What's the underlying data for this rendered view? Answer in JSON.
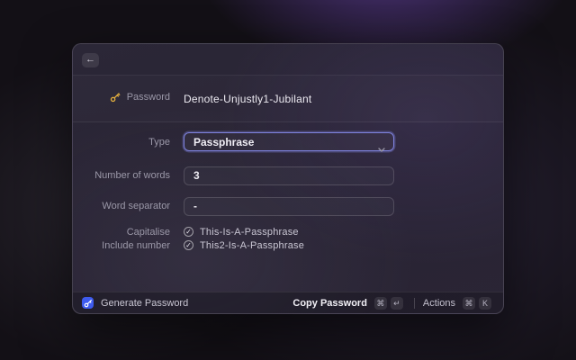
{
  "window": {
    "back_icon": "←",
    "header": {
      "field_label": "Password",
      "password_value": "Denote-Unjustly1-Jubilant"
    },
    "form": {
      "type": {
        "label": "Type",
        "value": "Passphrase"
      },
      "number_of_words": {
        "label": "Number of words",
        "value": "3"
      },
      "word_separator": {
        "label": "Word separator",
        "value": "-"
      },
      "capitalise": {
        "label": "Capitalise",
        "value": "This-Is-A-Passphrase",
        "checked": true
      },
      "include_number": {
        "label": "Include number",
        "value": "This2-Is-A-Passphrase",
        "checked": true
      }
    },
    "footer": {
      "primary_action": "Generate Password",
      "copy_action": "Copy Password",
      "copy_keys": [
        "⌘",
        "↵"
      ],
      "actions_label": "Actions",
      "actions_keys": [
        "⌘",
        "K"
      ]
    }
  },
  "icons": {
    "back": "←",
    "check": "✓",
    "key_gold": "key-icon",
    "key_blue": "key-icon",
    "chevron_down": "chevron-down"
  },
  "colors": {
    "accent_blue": "#3e5bed",
    "key_gold": "#e2ae3e",
    "focus_ring": "#7e82dd",
    "background_glow": "#7c50cd"
  }
}
